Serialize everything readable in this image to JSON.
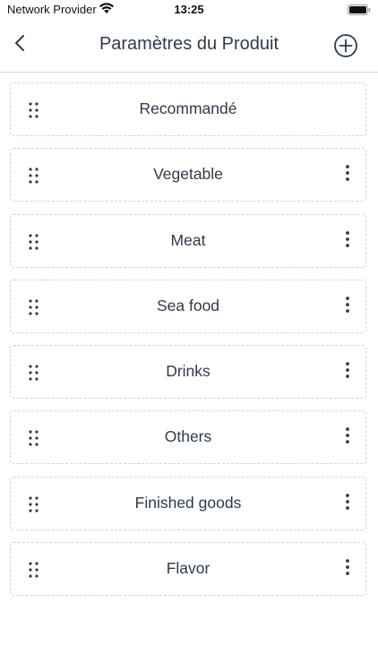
{
  "status_bar": {
    "carrier": "Network Provider",
    "time": "13:25",
    "wifi_icon": "wifi-icon",
    "battery_icon": "battery-icon"
  },
  "nav": {
    "title": "Paramètres du Produit",
    "back_icon": "chevron-left-icon",
    "add_icon": "plus-circle-icon"
  },
  "categories": [
    {
      "label": "Recommandé",
      "has_menu": false
    },
    {
      "label": "Vegetable",
      "has_menu": true
    },
    {
      "label": "Meat",
      "has_menu": true
    },
    {
      "label": "Sea food",
      "has_menu": true
    },
    {
      "label": "Drinks",
      "has_menu": true
    },
    {
      "label": "Others",
      "has_menu": true
    },
    {
      "label": "Finished goods",
      "has_menu": true
    },
    {
      "label": "Flavor",
      "has_menu": true
    }
  ],
  "colors": {
    "text": "#2f3b4a",
    "border": "#cfd4da",
    "divider": "#d9dde2"
  }
}
